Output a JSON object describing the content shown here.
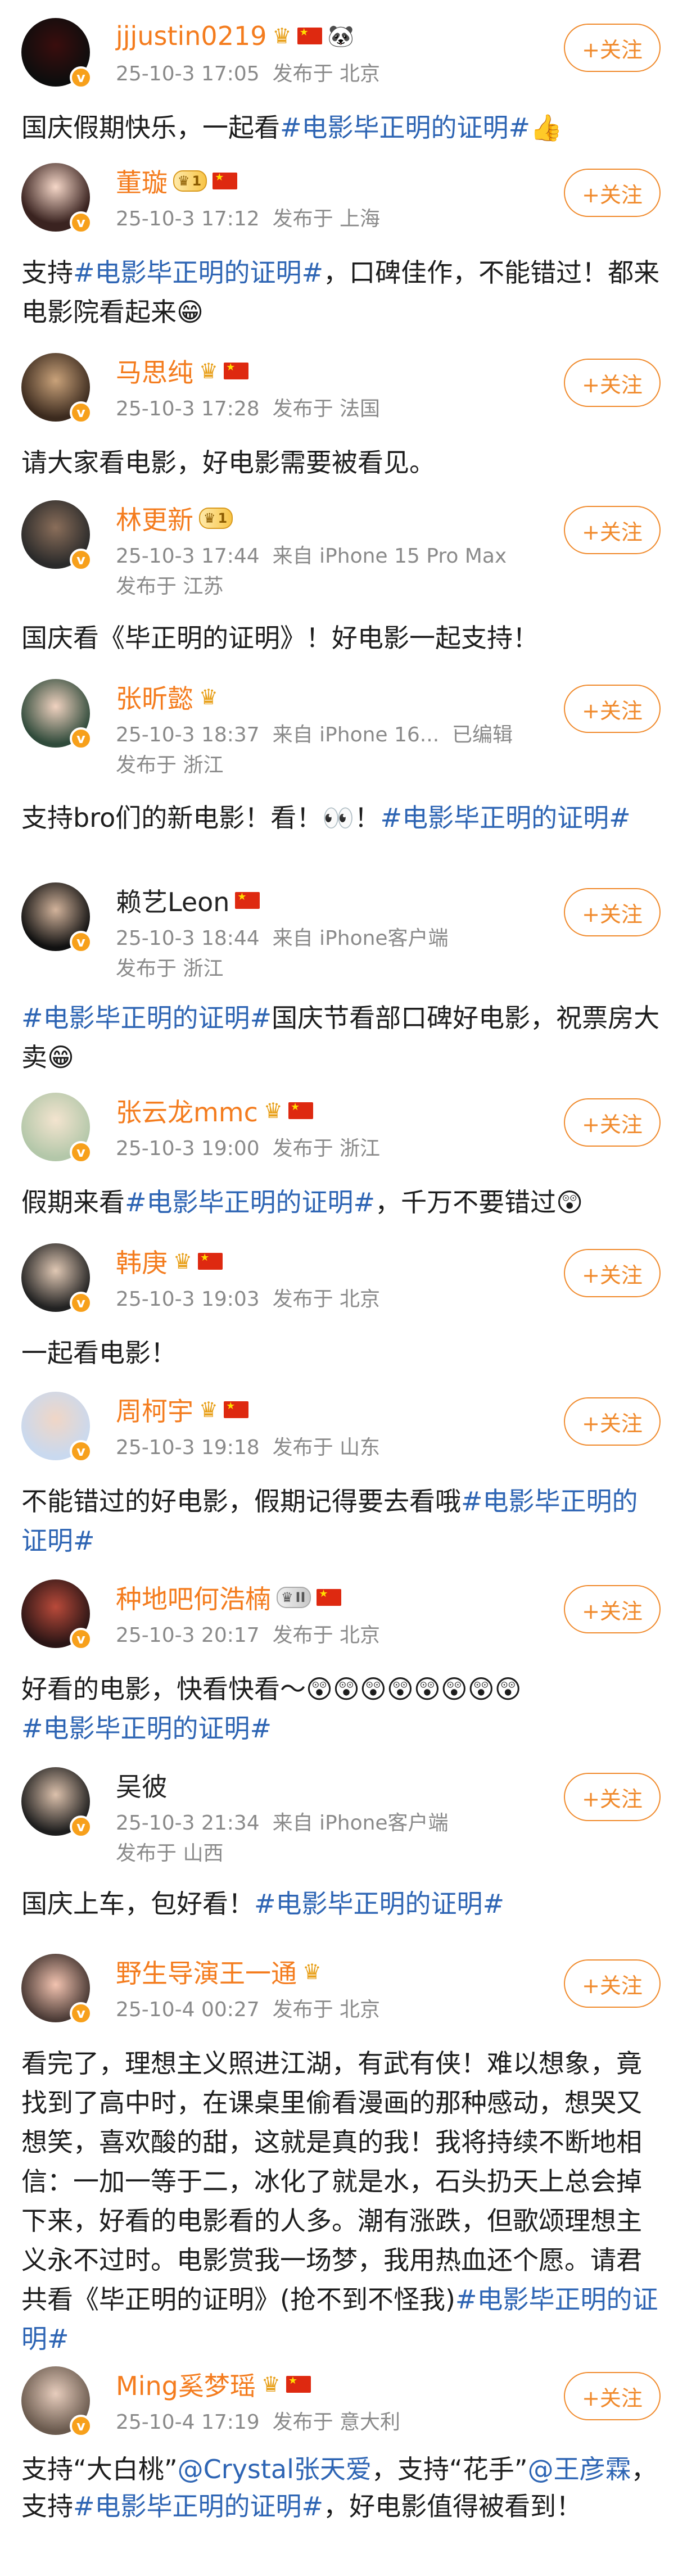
{
  "follow_label": "+关注",
  "posts": [
    {
      "name": "jjjustin0219",
      "time": "25-10-3 17:05",
      "loc": "发布于 北京",
      "text": "国庆假期快乐，一起看",
      "tag": "#电影毕正明的证明#",
      "text2": "👍"
    },
    {
      "name": "董璇",
      "level": "1",
      "time": "25-10-3 17:12",
      "loc": "发布于 上海",
      "text": "支持",
      "tag": "#电影毕正明的证明#",
      "text2": "，口碑佳作，不能错过！都来电影院看起来😁"
    },
    {
      "name": "马思纯",
      "time": "25-10-3 17:28",
      "loc": "发布于 法国",
      "text": "请大家看电影，好电影需要被看见。"
    },
    {
      "name": "林更新",
      "level": "1",
      "time": "25-10-3 17:44",
      "device": "来自 iPhone 15 Pro Max",
      "loc": "发布于 江苏",
      "text": "国庆看《毕正明的证明》！好电影一起支持！"
    },
    {
      "name": "张昕懿",
      "time": "25-10-3 18:37",
      "device": "来自 iPhone 16...",
      "edited": "已编辑",
      "loc": "发布于 浙江",
      "text": "支持bro们的新电影！看！👀！",
      "tag": "#电影毕正明的证明#"
    },
    {
      "name": "赖艺Leon",
      "time": "25-10-3 18:44",
      "device": "来自 iPhone客户端",
      "loc": "发布于 浙江",
      "tag": "#电影毕正明的证明#",
      "text2": "国庆节看部口碑好电影，祝票房大卖😁"
    },
    {
      "name": "张云龙mmc",
      "time": "25-10-3 19:00",
      "loc": "发布于 浙江",
      "text": "假期来看",
      "tag": "#电影毕正明的证明#",
      "text2": "，千万不要错过😲"
    },
    {
      "name": "韩庚",
      "time": "25-10-3 19:03",
      "loc": "发布于 北京",
      "text": "一起看电影！"
    },
    {
      "name": "周柯宇",
      "time": "25-10-3 19:18",
      "loc": "发布于 山东",
      "text": "不能错过的好电影，假期记得要去看哦",
      "tag": "#电影毕正明的证明#"
    },
    {
      "name": "种地吧何浩楠",
      "level": "II",
      "time": "25-10-3 20:17",
      "loc": "发布于 北京",
      "text": "好看的电影，快看快看～😲😲😲😲😲😲😲😲",
      "tag": "#电影毕正明的证明#"
    },
    {
      "name": "吴彼",
      "time": "25-10-3 21:34",
      "device": "来自 iPhone客户端",
      "loc": "发布于 山西",
      "text": "国庆上车，包好看！",
      "tag": "#电影毕正明的证明#"
    },
    {
      "name": "野生导演王一通",
      "time": "25-10-4 00:27",
      "loc": "发布于 北京",
      "text": "看完了，理想主义照进江湖，有武有侠！难以想象，竟找到了高中时，在课桌里偷看漫画的那种感动，想哭又想笑，喜欢酸的甜，这就是真的我！我将持续不断地相信：一加一等于二，冰化了就是水，石头扔天上总会掉下来，好看的电影看的人多。潮有涨跌，但歌颂理想主义永不过时。电影赏我一场梦，我用热血还个愿。请君共看《毕正明的证明》(抢不到不怪我)",
      "tag": "#电影毕正明的证明#"
    },
    {
      "name": "Ming奚梦瑶",
      "time": "25-10-4 17:19",
      "loc": "发布于 意大利",
      "text": "支持“大白桃”",
      "mention1": "@Crystal张天爱",
      "text_mid": "，支持“花手”",
      "mention2": "@王彦霖",
      "text_mid2": "，支持",
      "tag": "#电影毕正明的证明#",
      "text2": "，好电影值得被看到！"
    }
  ]
}
